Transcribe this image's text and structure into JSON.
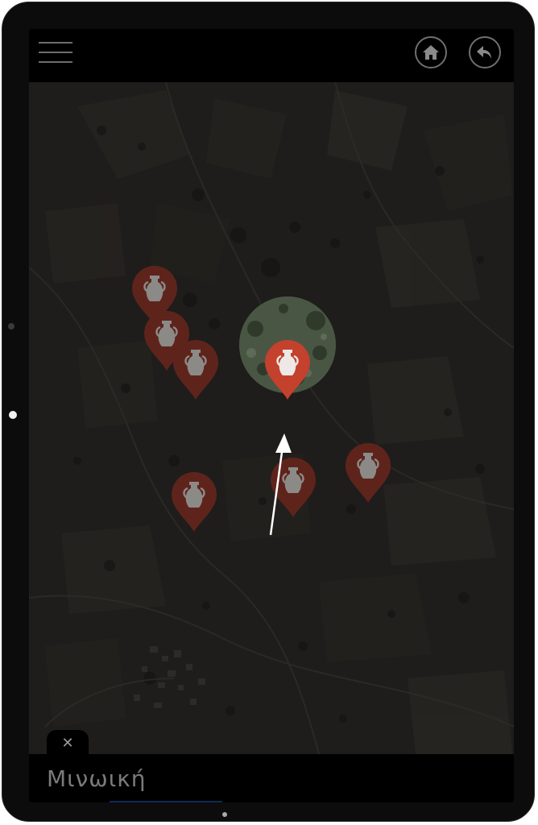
{
  "header": {
    "menu_icon": "hamburger-menu-icon",
    "home_icon": "home-icon",
    "back_icon": "back-arrow-icon"
  },
  "map": {
    "marker_icon": "amphora-icon",
    "marker_color": "#7a2a20",
    "selected_marker_color": "#c9432f",
    "marker_count": 7
  },
  "info_panel": {
    "title": "Μινωική",
    "close_label": "✕"
  }
}
